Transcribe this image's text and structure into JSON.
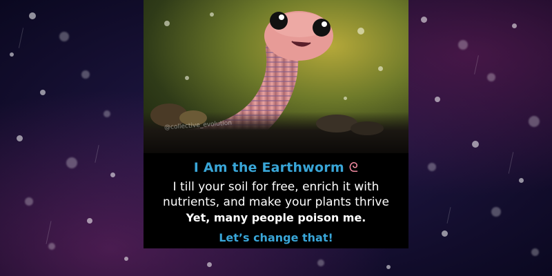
{
  "card": {
    "watermark": "@collective_evolution",
    "title": "I Am the Earthworm",
    "title_emoji": "ᘓ",
    "body_line_1": "I till your soil for free, enrich it with",
    "body_line_2": "nutrients, and make your plants thrive",
    "bold_line": "Yet, many people poison me.",
    "cta": "Let’s change that!"
  },
  "colors": {
    "accent_blue": "#39a6d8",
    "text_white": "#ffffff",
    "worm_pink": "#e9a3a0"
  },
  "illustration": "cartoon-earthworm"
}
